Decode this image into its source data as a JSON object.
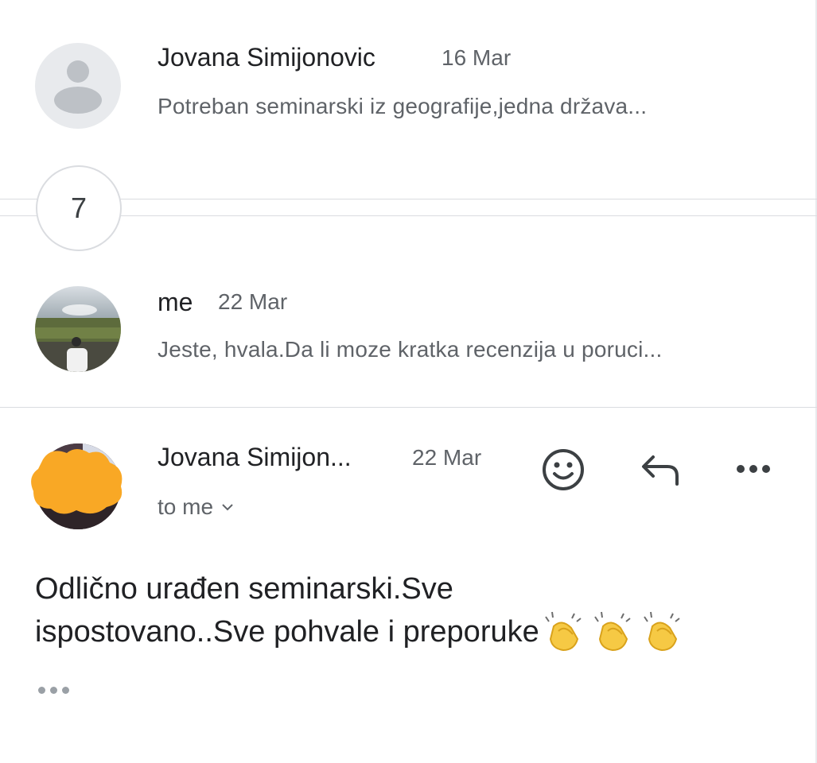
{
  "thread": {
    "messages": [
      {
        "sender": "Jovana Simijonovic",
        "date": "16 Mar",
        "snippet": "Potreban seminarski iz geografije,jedna država...",
        "avatar": "default-person-avatar"
      },
      {
        "sender": "me",
        "date": "22 Mar",
        "snippet": "Jeste, hvala.Da li moze kratka recenzija u poruci...",
        "avatar": "photo-avatar"
      }
    ],
    "collapsed_count": "7",
    "open_message": {
      "sender": "Jovana Simijon...",
      "date": "22 Mar",
      "recipient": "to me",
      "body_line1": "Odlično urađen seminarski.Sve",
      "body_line2": "ispostovano..Sve pohvale i preporuke",
      "body_emoji": "clapping-hands x3",
      "actions": [
        "emoji-reaction-icon",
        "reply-icon",
        "more-options-icon"
      ]
    }
  },
  "colors": {
    "text_primary": "#202124",
    "text_secondary": "#5f6368",
    "divider": "#dadce0",
    "redaction": "#f9a825"
  }
}
